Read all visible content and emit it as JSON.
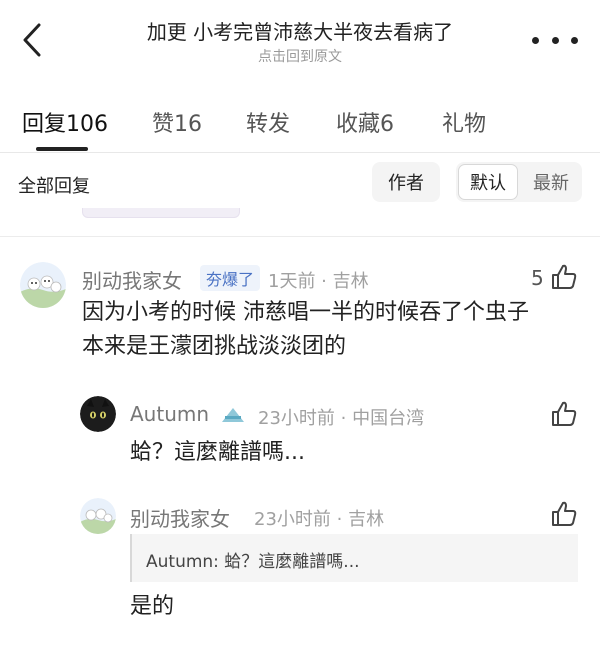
{
  "header": {
    "title": "加更 小考完曾沛慈大半夜去看病了",
    "subtitle": "点击回到原文",
    "back_icon": "chevron-left-icon",
    "more_icon": "more-dots-icon"
  },
  "tabs": [
    {
      "label": "回复106",
      "active": true
    },
    {
      "label": "赞16",
      "active": false
    },
    {
      "label": "转发",
      "active": false
    },
    {
      "label": "收藏6",
      "active": false
    },
    {
      "label": "礼物",
      "active": false
    }
  ],
  "filter": {
    "all_label": "全部回复",
    "author_label": "作者",
    "sort_options": [
      "默认",
      "最新"
    ],
    "selected_sort": "默认"
  },
  "comments": {
    "main": {
      "user": "别动我家女",
      "badge": "夯爆了",
      "meta": "1天前 · 吉林",
      "likes": "5",
      "text_line1": "因为小考的时候 沛慈唱一半的时候吞了个虫子",
      "text_line2": "本来是王濛团挑战淡淡团的"
    },
    "reply1": {
      "user": "Autumn",
      "meta": "23小时前 · 中国台湾",
      "text": "蛤？這麼離譜嗎..."
    },
    "reply2": {
      "user": "别动我家女",
      "meta": "23小时前 · 吉林",
      "quote": "Autumn: 蛤？這麼離譜嗎...",
      "text": "是的"
    }
  },
  "colors": {
    "badge_bg": "#eef3fb",
    "badge_text": "#4a72c4",
    "meta_text": "#a0a0a0",
    "username_text": "#777777"
  }
}
